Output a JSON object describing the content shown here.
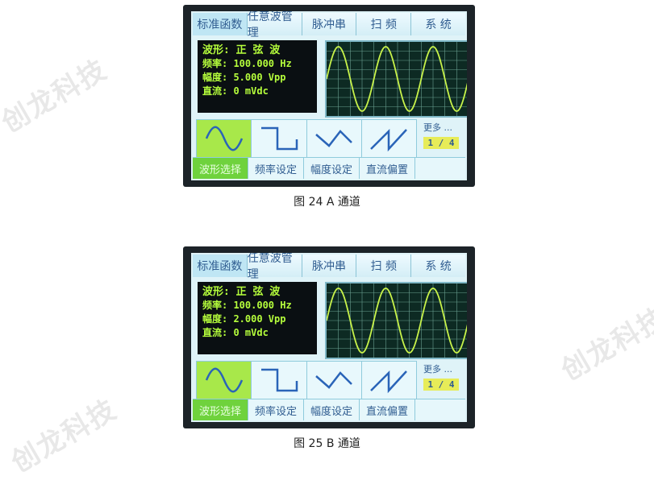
{
  "watermark": "创龙科技",
  "colors": {
    "waveform": "#c8f34a",
    "grid": "#6a9f90",
    "accent_green": "#a8e84a",
    "tab_text": "#2f5c90"
  },
  "figures": [
    {
      "caption": "图  24 A 通道",
      "tabs": [
        "标准函数",
        "任意波管理",
        "脉冲串",
        "扫  频",
        "系  统"
      ],
      "info": {
        "waveform": "波形: 正 弦 波",
        "frequency": "频率: 100.000 Hz",
        "amplitude": "幅度: 5.000 Vpp",
        "dc": "直流: 0 mVdc"
      },
      "wave_buttons": [
        "sine-icon",
        "square-icon",
        "triangle-icon",
        "sawtooth-icon"
      ],
      "more_label": "更多 ...",
      "page_indicator": "1 / 4",
      "softkeys": [
        "波形选择",
        "频率设定",
        "幅度设定",
        "直流偏置"
      ]
    },
    {
      "caption": "图  25 B 通道",
      "tabs": [
        "标准函数",
        "任意波管理",
        "脉冲串",
        "扫  频",
        "系  统"
      ],
      "info": {
        "waveform": "波形: 正 弦 波",
        "frequency": "频率: 100.000 Hz",
        "amplitude": "幅度: 2.000 Vpp",
        "dc": "直流: 0 mVdc"
      },
      "wave_buttons": [
        "sine-icon",
        "square-icon",
        "triangle-icon",
        "sawtooth-icon"
      ],
      "more_label": "更多 ...",
      "page_indicator": "1 / 4",
      "softkeys": [
        "波形选择",
        "频率设定",
        "幅度设定",
        "直流偏置"
      ]
    }
  ]
}
